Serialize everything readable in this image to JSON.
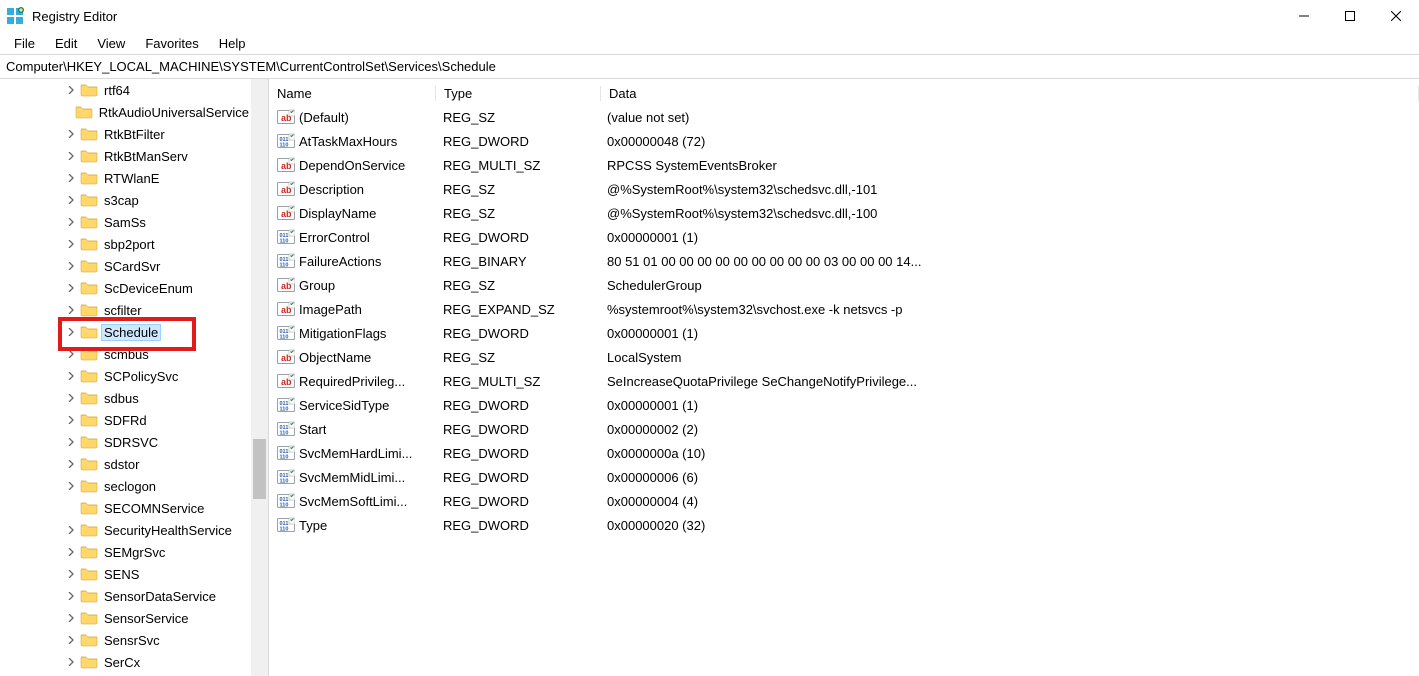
{
  "window": {
    "title": "Registry Editor"
  },
  "menus": [
    "File",
    "Edit",
    "View",
    "Favorites",
    "Help"
  ],
  "path": "Computer\\HKEY_LOCAL_MACHINE\\SYSTEM\\CurrentControlSet\\Services\\Schedule",
  "tree": [
    {
      "label": "rtf64",
      "expandable": true
    },
    {
      "label": "RtkAudioUniversalService",
      "expandable": false
    },
    {
      "label": "RtkBtFilter",
      "expandable": true
    },
    {
      "label": "RtkBtManServ",
      "expandable": true
    },
    {
      "label": "RTWlanE",
      "expandable": true
    },
    {
      "label": "s3cap",
      "expandable": true
    },
    {
      "label": "SamSs",
      "expandable": true
    },
    {
      "label": "sbp2port",
      "expandable": true
    },
    {
      "label": "SCardSvr",
      "expandable": true
    },
    {
      "label": "ScDeviceEnum",
      "expandable": true
    },
    {
      "label": "scfilter",
      "expandable": true
    },
    {
      "label": "Schedule",
      "expandable": true,
      "selected": true,
      "highlight": true
    },
    {
      "label": "scmbus",
      "expandable": true
    },
    {
      "label": "SCPolicySvc",
      "expandable": true
    },
    {
      "label": "sdbus",
      "expandable": true
    },
    {
      "label": "SDFRd",
      "expandable": true
    },
    {
      "label": "SDRSVC",
      "expandable": true
    },
    {
      "label": "sdstor",
      "expandable": true
    },
    {
      "label": "seclogon",
      "expandable": true
    },
    {
      "label": "SECOMNService",
      "expandable": false
    },
    {
      "label": "SecurityHealthService",
      "expandable": true
    },
    {
      "label": "SEMgrSvc",
      "expandable": true
    },
    {
      "label": "SENS",
      "expandable": true
    },
    {
      "label": "SensorDataService",
      "expandable": true
    },
    {
      "label": "SensorService",
      "expandable": true
    },
    {
      "label": "SensrSvc",
      "expandable": true
    },
    {
      "label": "SerCx",
      "expandable": true
    }
  ],
  "columns": {
    "name": "Name",
    "type": "Type",
    "data": "Data"
  },
  "values": [
    {
      "name": "(Default)",
      "kind": "sz",
      "type": "REG_SZ",
      "data": "(value not set)"
    },
    {
      "name": "AtTaskMaxHours",
      "kind": "num",
      "type": "REG_DWORD",
      "data": "0x00000048 (72)"
    },
    {
      "name": "DependOnService",
      "kind": "sz",
      "type": "REG_MULTI_SZ",
      "data": "RPCSS SystemEventsBroker"
    },
    {
      "name": "Description",
      "kind": "sz",
      "type": "REG_SZ",
      "data": "@%SystemRoot%\\system32\\schedsvc.dll,-101"
    },
    {
      "name": "DisplayName",
      "kind": "sz",
      "type": "REG_SZ",
      "data": "@%SystemRoot%\\system32\\schedsvc.dll,-100"
    },
    {
      "name": "ErrorControl",
      "kind": "num",
      "type": "REG_DWORD",
      "data": "0x00000001 (1)"
    },
    {
      "name": "FailureActions",
      "kind": "num",
      "type": "REG_BINARY",
      "data": "80 51 01 00 00 00 00 00 00 00 00 00 03 00 00 00 14..."
    },
    {
      "name": "Group",
      "kind": "sz",
      "type": "REG_SZ",
      "data": "SchedulerGroup"
    },
    {
      "name": "ImagePath",
      "kind": "sz",
      "type": "REG_EXPAND_SZ",
      "data": "%systemroot%\\system32\\svchost.exe -k netsvcs -p"
    },
    {
      "name": "MitigationFlags",
      "kind": "num",
      "type": "REG_DWORD",
      "data": "0x00000001 (1)"
    },
    {
      "name": "ObjectName",
      "kind": "sz",
      "type": "REG_SZ",
      "data": "LocalSystem"
    },
    {
      "name": "RequiredPrivileg...",
      "kind": "sz",
      "type": "REG_MULTI_SZ",
      "data": "SeIncreaseQuotaPrivilege SeChangeNotifyPrivilege..."
    },
    {
      "name": "ServiceSidType",
      "kind": "num",
      "type": "REG_DWORD",
      "data": "0x00000001 (1)"
    },
    {
      "name": "Start",
      "kind": "num",
      "type": "REG_DWORD",
      "data": "0x00000002 (2)"
    },
    {
      "name": "SvcMemHardLimi...",
      "kind": "num",
      "type": "REG_DWORD",
      "data": "0x0000000a (10)"
    },
    {
      "name": "SvcMemMidLimi...",
      "kind": "num",
      "type": "REG_DWORD",
      "data": "0x00000006 (6)"
    },
    {
      "name": "SvcMemSoftLimi...",
      "kind": "num",
      "type": "REG_DWORD",
      "data": "0x00000004 (4)"
    },
    {
      "name": "Type",
      "kind": "num",
      "type": "REG_DWORD",
      "data": "0x00000020 (32)"
    }
  ]
}
